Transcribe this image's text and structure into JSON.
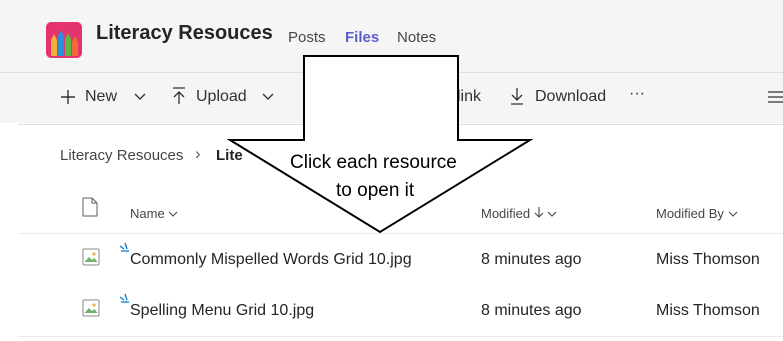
{
  "header": {
    "team_name": "Literacy Resouces",
    "tabs": [
      {
        "label": "Posts"
      },
      {
        "label": "Files",
        "active": true
      },
      {
        "label": "Notes"
      }
    ]
  },
  "toolbar": {
    "new_label": "New",
    "upload_label": "Upload",
    "link_label": "link",
    "download_label": "Download",
    "more_label": "···"
  },
  "breadcrumb": {
    "root": "Literacy Resouces",
    "current": "Lite"
  },
  "table": {
    "headers": {
      "name": "Name",
      "modified": "Modified",
      "modified_by": "Modified By"
    },
    "rows": [
      {
        "name": "Commonly Mispelled Words Grid 10.jpg",
        "modified": "8 minutes ago",
        "modified_by": "Miss Thomson"
      },
      {
        "name": "Spelling Menu Grid 10.jpg",
        "modified": "8 minutes ago",
        "modified_by": "Miss Thomson"
      }
    ]
  },
  "callout": {
    "line1": "Click each resource",
    "line2": "to open it"
  },
  "colors": {
    "accent": "#5b5fc7",
    "new_badge": "#0078d4",
    "chrome_bg": "#f5f5f5"
  }
}
